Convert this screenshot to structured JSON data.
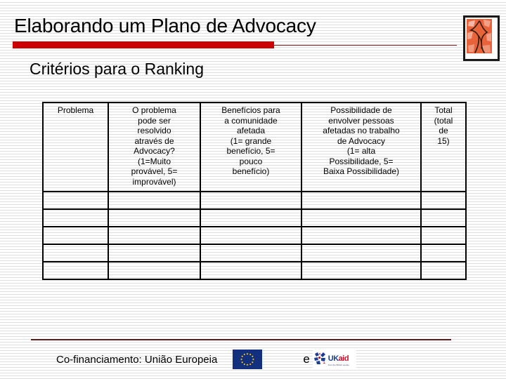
{
  "slide": {
    "title": "Elaborando um Plano de Advocacy",
    "subtitle": "Critérios para o Ranking",
    "accent_color_thick": "#cc0000",
    "accent_color_thin": "#8d1c1c",
    "background_color": "#ffffff"
  },
  "decoration": {
    "name": "abstract-figure-art",
    "fill_color": "#e8633a",
    "border_color": "#1a1a1a"
  },
  "table": {
    "columns": [
      "Problema",
      "O problema pode ser resolvido através de Advocacy? (1=Muito provável, 5= improvável)",
      "Benefícios para a comunidade afetada (1= grande benefício, 5= pouco benefício)",
      "Possibilidade de envolver pessoas afetadas no trabalho de Advocacy (1= alta Possibilidade, 5= Baixa Possibilidade)",
      "Total (total de 15)"
    ],
    "headers": [
      {
        "lines": [
          "Problema"
        ]
      },
      {
        "lines": [
          "O problema",
          "pode ser",
          "resolvido",
          "através de",
          "Advocacy?",
          "(1=Muito",
          "provável, 5=",
          "improvável)"
        ]
      },
      {
        "lines": [
          "Benefícios para",
          "a comunidade",
          "afetada",
          "(1= grande",
          "benefício, 5=",
          "pouco",
          "benefício)"
        ]
      },
      {
        "lines": [
          "Possibilidade de",
          "envolver pessoas",
          "afetadas no trabalho",
          "de Advocacy",
          "(1= alta",
          "Possibilidade, 5=",
          "Baixa Possibilidade)"
        ]
      },
      {
        "lines": [
          "Total",
          "(total",
          "de",
          "15)"
        ]
      }
    ],
    "empty_row_count": 5,
    "border_color": "#000000"
  },
  "footer": {
    "text": "Co-financiamento:  União Europeia",
    "conjunction": "e",
    "eu_flag": {
      "name": "european-union-flag",
      "background_color": "#13307e",
      "star_color": "#ffcc00",
      "star_count": 12
    },
    "ukaid": {
      "name": "ukaid-logo",
      "uk_text": "UK",
      "aid_text": "aid",
      "sub_text": "from the British people",
      "uk_color": "#1c3f94",
      "aid_color": "#c8102e"
    },
    "rule_color": "#5e1b1b"
  }
}
